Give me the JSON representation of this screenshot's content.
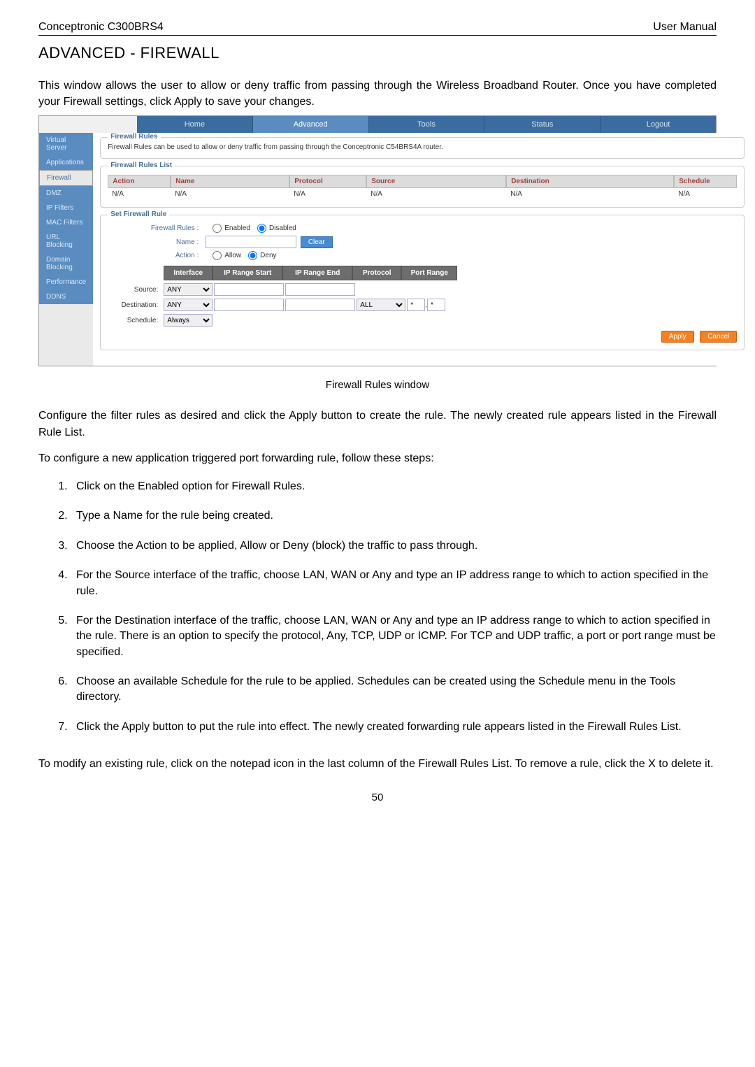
{
  "header": {
    "product": "Conceptronic C300BRS4",
    "doc": "User Manual"
  },
  "title": "ADVANCED - FIREWALL",
  "intro": "This window allows the user to allow or deny traffic from passing through the Wireless Broadband Router. Once you have completed your Firewall settings, click Apply to save your changes.",
  "tabs": {
    "home": "Home",
    "advanced": "Advanced",
    "tools": "Tools",
    "status": "Status",
    "logout": "Logout"
  },
  "sidebar": {
    "items": [
      "Virtual Server",
      "Applications",
      "Firewall",
      "DMZ",
      "IP Filters",
      "MAC Filters",
      "URL Blocking",
      "Domain Blocking",
      "Performance",
      "DDNS"
    ]
  },
  "panels": {
    "rules_desc_legend": "Firewall Rules",
    "rules_desc_text": "Firewall Rules can be used to allow or deny traffic from passing through the Conceptronic C54BRS4A router.",
    "rules_list_legend": "Firewall Rules List",
    "cols": {
      "action": "Action",
      "name": "Name",
      "protocol": "Protocol",
      "source": "Source",
      "destination": "Destination",
      "schedule": "Schedule"
    },
    "row": {
      "action": "N/A",
      "name": "N/A",
      "protocol": "N/A",
      "source": "N/A",
      "destination": "N/A",
      "schedule": "N/A"
    },
    "set_legend": "Set Firewall Rule",
    "labels": {
      "firewall_rules": "Firewall Rules :",
      "enabled": "Enabled",
      "disabled": "Disabled",
      "name": "Name :",
      "clear": "Clear",
      "action": "Action :",
      "allow": "Allow",
      "deny": "Deny",
      "interface": "Interface",
      "ip_start": "IP Range Start",
      "ip_end": "IP Range End",
      "protocol": "Protocol",
      "port_range": "Port Range",
      "source": "Source:",
      "destination": "Destination:",
      "schedule": "Schedule:",
      "any": "ANY",
      "all": "ALL",
      "always": "Always",
      "apply": "Apply",
      "cancel": "Cancel",
      "star": "*",
      "comma": ","
    }
  },
  "caption": "Firewall Rules window",
  "body1": "Configure the filter rules as desired and click the Apply button to create the rule. The newly created rule appears listed in the Firewall Rule List.",
  "body2": "To configure a new application triggered port forwarding rule, follow these steps:",
  "steps": [
    "Click on the Enabled option for Firewall Rules.",
    "Type a Name for the rule being created.",
    "Choose the Action to be applied, Allow or Deny (block) the traffic to pass through.",
    "For the Source interface of the traffic, choose LAN, WAN or Any and type an IP address range to which to action specified in the rule.",
    "For the Destination interface of the traffic, choose LAN, WAN or Any and type an IP address range to which to action specified in the rule. There is an option to specify the protocol, Any, TCP, UDP or ICMP. For TCP and UDP traffic, a port or port range must be specified.",
    "Choose an available Schedule for the rule to be applied. Schedules can be created using the Schedule menu in the Tools directory.",
    "Click the Apply button to put the rule into effect. The newly created forwarding rule appears listed in the Firewall Rules List."
  ],
  "footer1": "To modify an existing rule, click on the notepad icon in the last column of the Firewall Rules List. To remove a rule, click the X to delete it.",
  "page": "50"
}
